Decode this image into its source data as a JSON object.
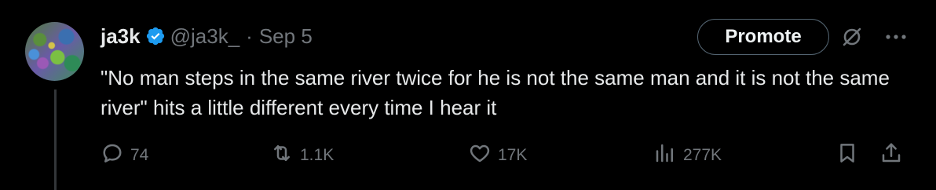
{
  "tweet": {
    "author_name": "ja3k",
    "handle": "@ja3k_",
    "separator": "·",
    "date": "Sep 5",
    "text": "\"No man steps in the same river twice for he is not the same man and it is not the same river\" hits a little different every time I hear it"
  },
  "header_actions": {
    "promote_label": "Promote"
  },
  "metrics": {
    "replies": "74",
    "retweets": "1.1K",
    "likes": "17K",
    "views": "277K"
  },
  "icons": {
    "verified": "verified-badge-icon",
    "grok": "grok-icon",
    "more": "more-icon",
    "reply": "reply-icon",
    "retweet": "retweet-icon",
    "like": "heart-icon",
    "views": "views-chart-icon",
    "bookmark": "bookmark-icon",
    "share": "share-icon"
  },
  "colors": {
    "background": "#000000",
    "text": "#e7e9ea",
    "muted": "#71767b",
    "verified": "#1d9bf0"
  }
}
